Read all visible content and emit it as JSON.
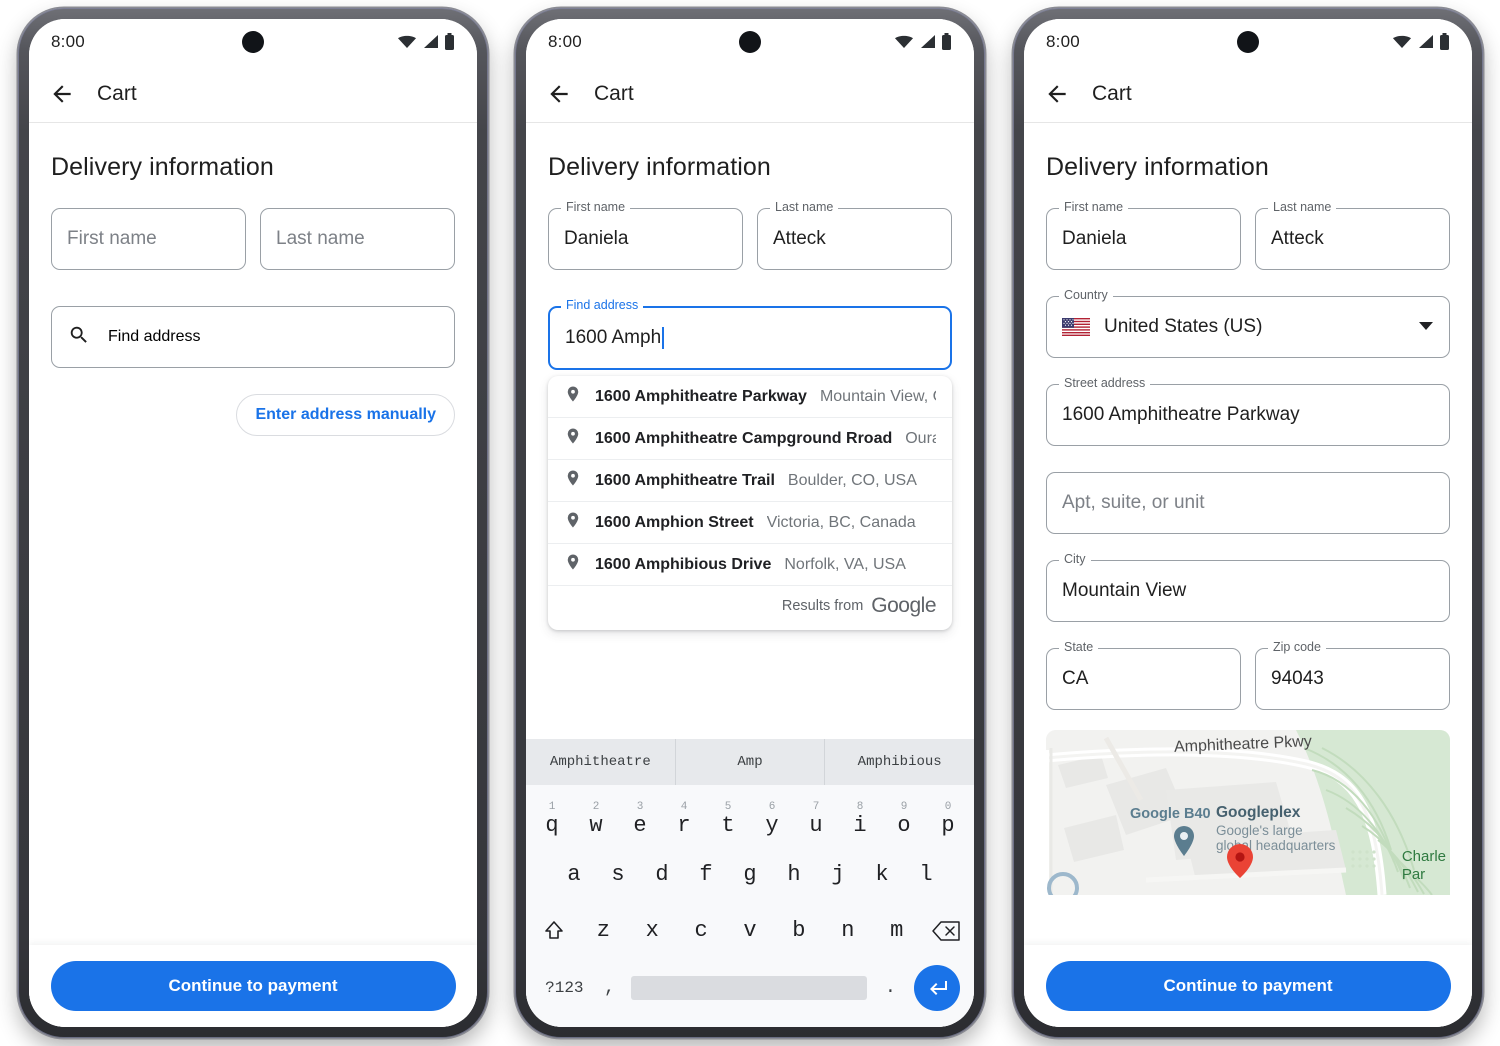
{
  "status_bar": {
    "time": "8:00",
    "icons": [
      "wifi-icon",
      "signal-icon",
      "battery-icon"
    ]
  },
  "app_bar": {
    "back_icon": "back-arrow-icon",
    "title": "Cart"
  },
  "section": {
    "title": "Delivery information"
  },
  "colors": {
    "accent": "#1a73e8",
    "outline": "#9aa0a6",
    "label": "#5f6368",
    "text": "#1f1f1f",
    "muted": "#70757a",
    "marker": "#ea4335"
  },
  "phone1": {
    "first_name": {
      "label": "First name",
      "placeholder": "First name",
      "value": ""
    },
    "last_name": {
      "label": "Last name",
      "placeholder": "Last name",
      "value": ""
    },
    "find_address": {
      "icon": "search-icon",
      "placeholder": "Find address",
      "value": ""
    },
    "manual_button": "Enter address manually",
    "cta": "Continue to payment"
  },
  "phone2": {
    "first_name": {
      "label": "First name",
      "value": "Daniela"
    },
    "last_name": {
      "label": "Last name",
      "value": "Atteck"
    },
    "find_address": {
      "label": "Find address",
      "value": "1600 Amph"
    },
    "suggestions": [
      {
        "icon": "place-pin-icon",
        "main": "1600 Amphitheatre Parkway",
        "secondary": "Mountain View, C..."
      },
      {
        "icon": "place-pin-icon",
        "main": "1600 Amphitheatre Campground Rroad",
        "secondary": "Ouray, ..."
      },
      {
        "icon": "place-pin-icon",
        "main": "1600 Amphitheatre Trail",
        "secondary": "Boulder, CO, USA"
      },
      {
        "icon": "place-pin-icon",
        "main": "1600 Amphion Street",
        "secondary": "Victoria, BC, Canada"
      },
      {
        "icon": "place-pin-icon",
        "main": "1600 Amphibious Drive",
        "secondary": "Norfolk, VA, USA"
      }
    ],
    "attribution": {
      "text": "Results from",
      "logo": "Google"
    },
    "keyboard": {
      "suggestions": [
        "Amphitheatre",
        "Amp",
        "Amphibious"
      ],
      "row1": [
        {
          "num": "1",
          "ltr": "q"
        },
        {
          "num": "2",
          "ltr": "w"
        },
        {
          "num": "3",
          "ltr": "e"
        },
        {
          "num": "4",
          "ltr": "r"
        },
        {
          "num": "5",
          "ltr": "t"
        },
        {
          "num": "6",
          "ltr": "y"
        },
        {
          "num": "7",
          "ltr": "u"
        },
        {
          "num": "8",
          "ltr": "i"
        },
        {
          "num": "9",
          "ltr": "o"
        },
        {
          "num": "0",
          "ltr": "p"
        }
      ],
      "row2": [
        "a",
        "s",
        "d",
        "f",
        "g",
        "h",
        "j",
        "k",
        "l"
      ],
      "row3": [
        "z",
        "x",
        "c",
        "v",
        "b",
        "n",
        "m"
      ],
      "shift_icon": "shift-icon",
      "backspace_icon": "backspace-icon",
      "symbols_key": "?123",
      "comma_key": ",",
      "period_key": ".",
      "enter_icon": "enter-icon"
    }
  },
  "phone3": {
    "first_name": {
      "label": "First name",
      "value": "Daniela"
    },
    "last_name": {
      "label": "Last name",
      "value": "Atteck"
    },
    "country": {
      "label": "Country",
      "value": "United States (US)",
      "flag": "us-flag-icon",
      "arrow": "chevron-down-icon"
    },
    "street": {
      "label": "Street address",
      "value": "1600 Amphitheatre Parkway"
    },
    "apt": {
      "placeholder": "Apt, suite, or unit",
      "value": ""
    },
    "city": {
      "label": "City",
      "value": "Mountain View"
    },
    "state": {
      "label": "State",
      "value": "CA"
    },
    "zip": {
      "label": "Zip code",
      "value": "94043"
    },
    "map": {
      "road_label": "Amphitheatre Pkwy",
      "poi_b40": "Google B40",
      "poi_title": "Googleplex",
      "poi_sub_line1": "Google's large",
      "poi_sub_line2": "global headquarters",
      "park_line1": "Charle",
      "park_line2": "Par",
      "marker": "map-pin-icon"
    },
    "cta": "Continue to payment"
  }
}
